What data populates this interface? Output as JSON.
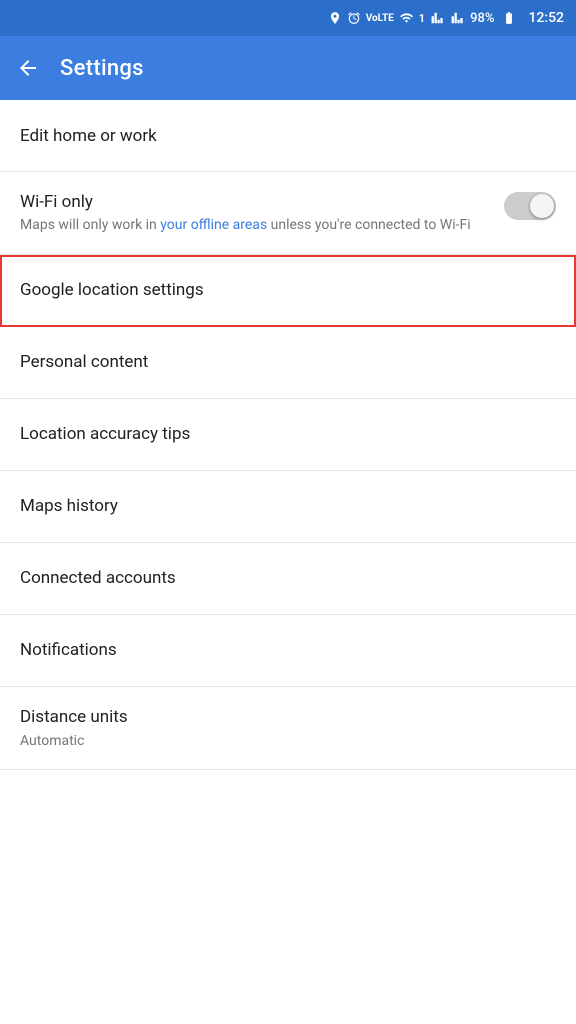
{
  "statusBar": {
    "time": "12:52",
    "battery": "98%",
    "icons": [
      "location",
      "alarm",
      "volte",
      "wifi",
      "notification",
      "signal1",
      "signal2",
      "battery"
    ]
  },
  "appBar": {
    "title": "Settings",
    "backLabel": "←"
  },
  "settings": {
    "items": [
      {
        "id": "edit-home-work",
        "title": "Edit home or work",
        "subtitle": "",
        "hasToggle": false,
        "highlighted": false
      },
      {
        "id": "wifi-only",
        "title": "Wi-Fi only",
        "subtitle": "Maps will only work in your offline areas unless you're connected to Wi-Fi",
        "subtitleLink": "your offline areas",
        "hasToggle": true,
        "toggleOn": false,
        "highlighted": false
      },
      {
        "id": "google-location-settings",
        "title": "Google location settings",
        "subtitle": "",
        "hasToggle": false,
        "highlighted": true
      },
      {
        "id": "personal-content",
        "title": "Personal content",
        "subtitle": "",
        "hasToggle": false,
        "highlighted": false
      },
      {
        "id": "location-accuracy-tips",
        "title": "Location accuracy tips",
        "subtitle": "",
        "hasToggle": false,
        "highlighted": false
      },
      {
        "id": "maps-history",
        "title": "Maps history",
        "subtitle": "",
        "hasToggle": false,
        "highlighted": false
      },
      {
        "id": "connected-accounts",
        "title": "Connected accounts",
        "subtitle": "",
        "hasToggle": false,
        "highlighted": false
      },
      {
        "id": "notifications",
        "title": "Notifications",
        "subtitle": "",
        "hasToggle": false,
        "highlighted": false
      },
      {
        "id": "distance-units",
        "title": "Distance units",
        "subtitle": "Automatic",
        "hasToggle": false,
        "highlighted": false
      }
    ]
  }
}
